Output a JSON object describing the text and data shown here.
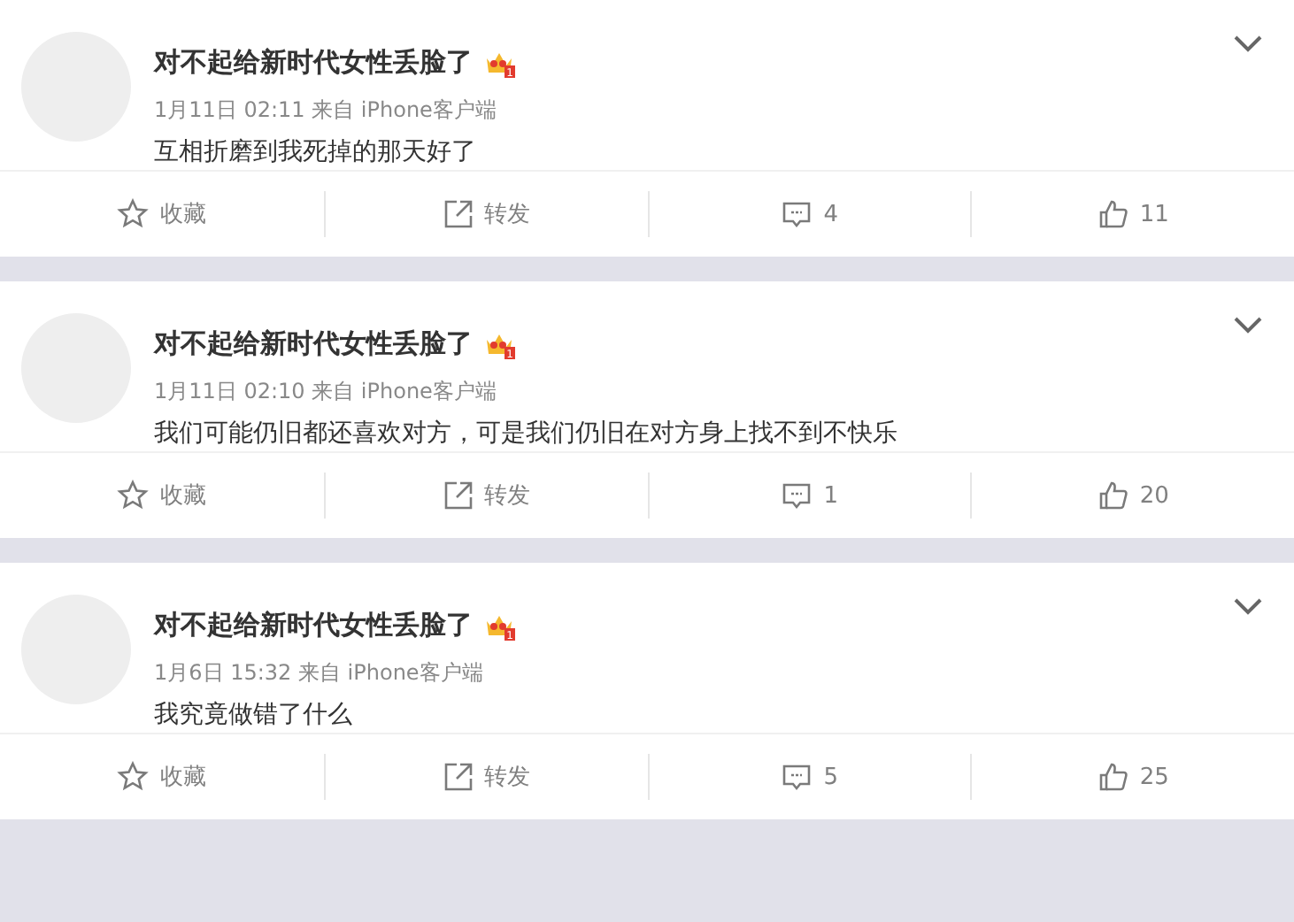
{
  "posts": [
    {
      "author": "对不起给新时代女性丢脸了",
      "badge": "1",
      "meta": "1月11日 02:11 来自 iPhone客户端",
      "text": "互相折磨到我死掉的那天好了",
      "actions": {
        "favorite": "收藏",
        "repost": "转发",
        "comments": "4",
        "likes": "11"
      }
    },
    {
      "author": "对不起给新时代女性丢脸了",
      "badge": "1",
      "meta": "1月11日 02:10 来自 iPhone客户端",
      "text": "我们可能仍旧都还喜欢对方，可是我们仍旧在对方身上找不到不快乐",
      "actions": {
        "favorite": "收藏",
        "repost": "转发",
        "comments": "1",
        "likes": "20"
      }
    },
    {
      "author": "对不起给新时代女性丢脸了",
      "badge": "1",
      "meta": "1月6日 15:32 来自 iPhone客户端",
      "text": "我究竟做错了什么",
      "actions": {
        "favorite": "收藏",
        "repost": "转发",
        "comments": "5",
        "likes": "25"
      }
    }
  ]
}
